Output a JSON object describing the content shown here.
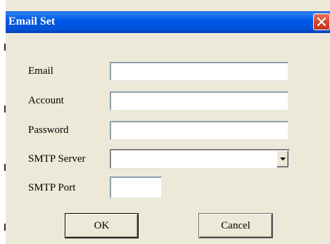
{
  "window": {
    "title": "Email Set",
    "close_glyph": "close-icon"
  },
  "form": {
    "email_label": "Email",
    "email_value": "",
    "account_label": "Account",
    "account_value": "",
    "password_label": "Password",
    "password_value": "",
    "smtp_server_label": "SMTP Server",
    "smtp_server_value": "",
    "smtp_port_label": "SMTP Port",
    "smtp_port_value": ""
  },
  "buttons": {
    "ok_label": "OK",
    "cancel_label": "Cancel"
  },
  "colors": {
    "titlebar": "#0055e5",
    "close": "#d8462b",
    "dialog_bg": "#ece9d8"
  }
}
